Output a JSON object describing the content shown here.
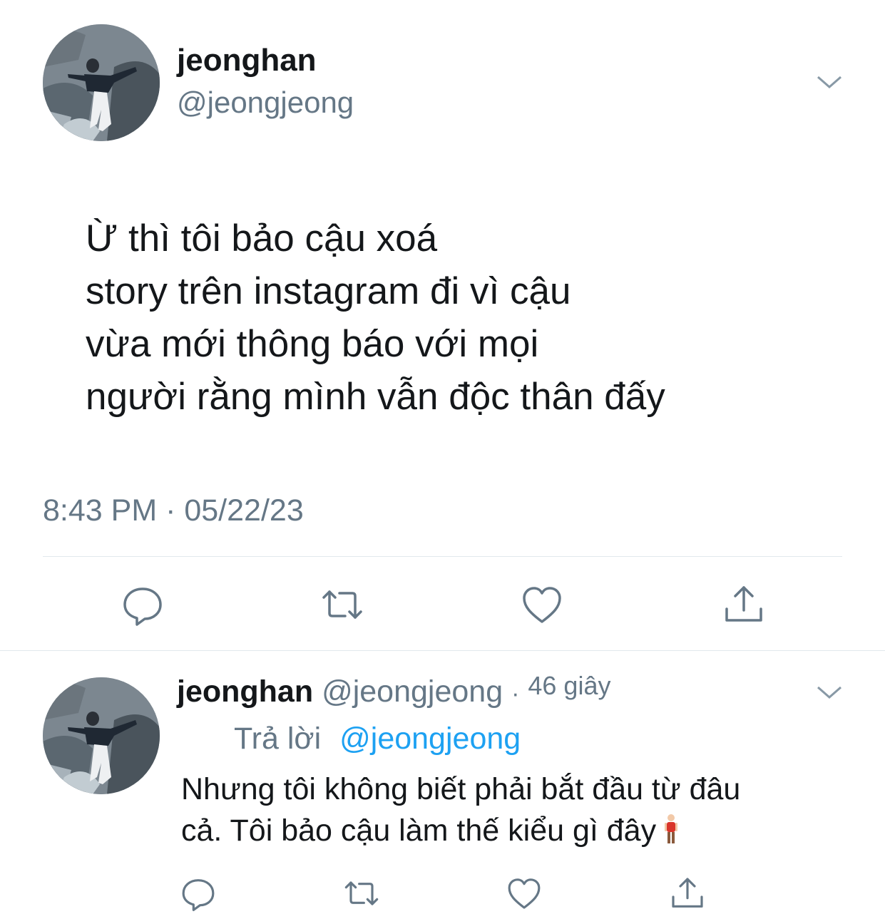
{
  "main_tweet": {
    "display_name": "jeonghan",
    "handle": "@jeongjeong",
    "text_lines": [
      "Ừ thì tôi bảo cậu xoá",
      "story trên instagram đi vì cậu",
      "vừa mới thông báo với mọi",
      "người rằng mình vẫn độc thân đấy"
    ],
    "timestamp": "8:43 PM · 05/22/23",
    "actions": [
      "reply-icon",
      "retweet-icon",
      "like-icon",
      "share-icon"
    ]
  },
  "reply_tweet": {
    "display_name": "jeonghan",
    "handle": "@jeongjeong",
    "separator": "·",
    "time_ago": "46 giây",
    "replying_label": "Trả lời",
    "replying_to": "@jeongjeong",
    "text_lines": [
      "Nhưng tôi không biết phải bắt đầu từ đâu",
      "cả. Tôi bảo cậu làm thế kiểu gì đây"
    ],
    "actions": [
      "reply-icon",
      "retweet-icon",
      "like-icon",
      "share-icon"
    ]
  },
  "colors": {
    "text": "#14171a",
    "secondary": "#657786",
    "link": "#1da1f2",
    "divider": "#e1e8ed"
  }
}
